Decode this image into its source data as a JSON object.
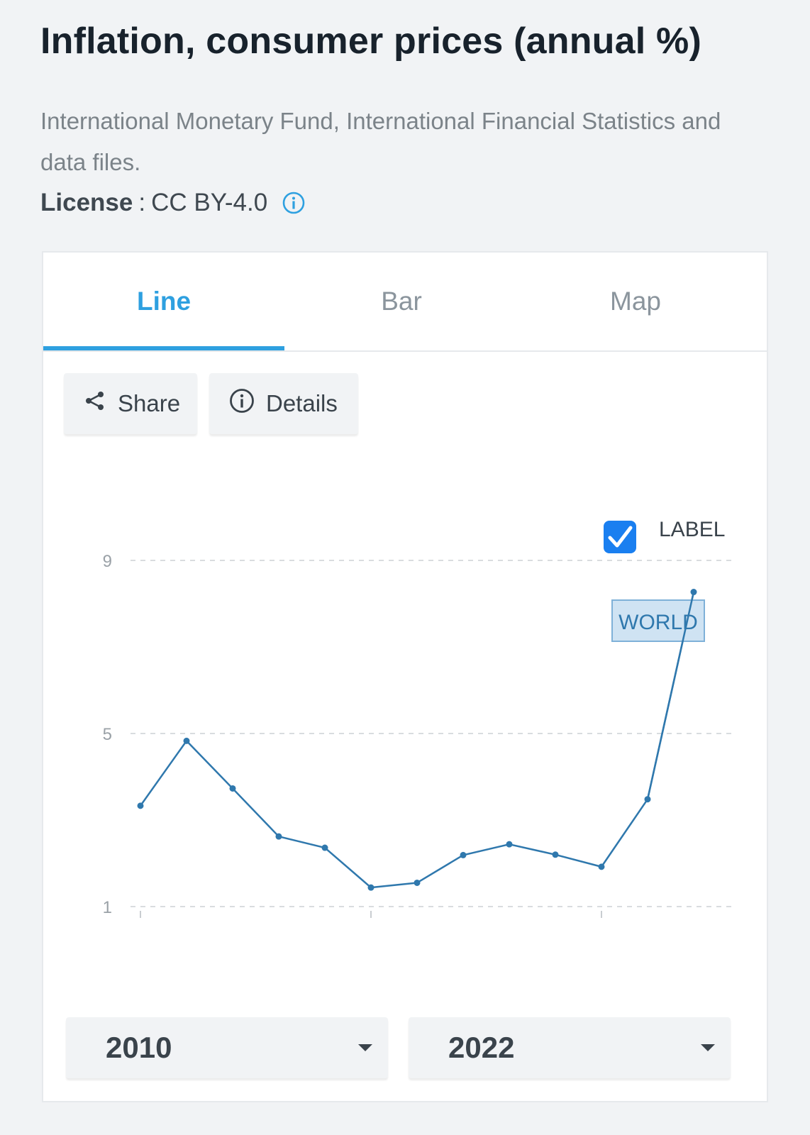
{
  "header": {
    "title": "Inflation, consumer prices (annual %)",
    "source": "International Monetary Fund, International Financial Statistics and data files.",
    "license_key": "License",
    "license_sep": ":",
    "license_value": "CC BY-4.0"
  },
  "tabs": [
    {
      "label": "Line",
      "active": true
    },
    {
      "label": "Bar",
      "active": false
    },
    {
      "label": "Map",
      "active": false
    }
  ],
  "toolbar": {
    "share_label": "Share",
    "details_label": "Details"
  },
  "legend": {
    "checkbox_label": "LABEL",
    "checked": true
  },
  "range": {
    "start_year": "2010",
    "end_year": "2022"
  },
  "colors": {
    "accent": "#2ea0e0",
    "series": "#2f78ad",
    "checkbox": "#1a7ff0"
  },
  "chart_data": {
    "type": "line",
    "series": [
      {
        "name": "WORLD",
        "x": [
          2010,
          2011,
          2012,
          2013,
          2014,
          2015,
          2016,
          2017,
          2018,
          2019,
          2020,
          2021,
          2022
        ],
        "values": [
          3.33,
          4.83,
          3.73,
          2.62,
          2.36,
          1.44,
          1.55,
          2.19,
          2.44,
          2.2,
          1.92,
          3.48,
          8.27
        ]
      }
    ],
    "y_ticks": [
      "9",
      "5",
      "1"
    ],
    "ylim": [
      1,
      9
    ],
    "xlim": [
      2010,
      2022
    ],
    "x_tick_marks": [
      2010,
      2015,
      2020
    ],
    "grid": true
  }
}
